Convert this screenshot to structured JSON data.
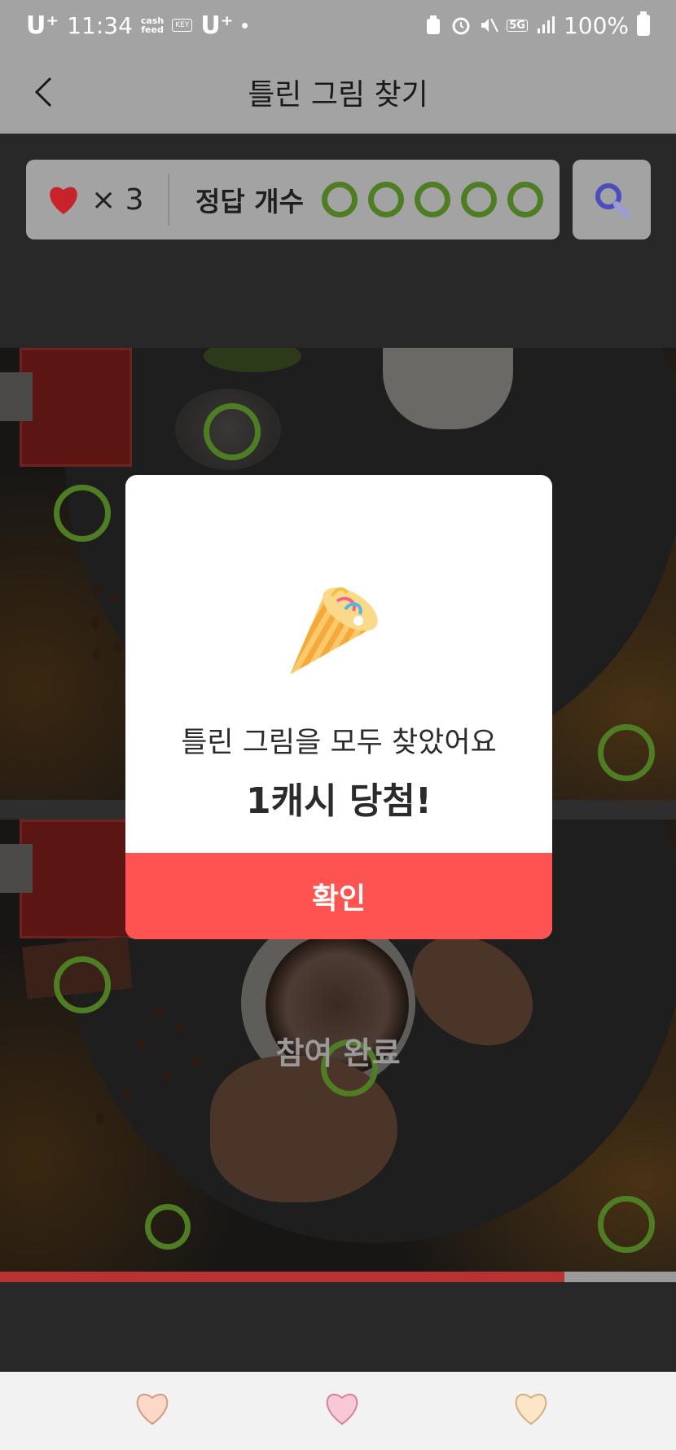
{
  "status_bar": {
    "carrier_left": "U⁺",
    "time": "11:34",
    "cashfeed_top": "cash",
    "cashfeed_bottom": "feed",
    "key_label": "KEY",
    "carrier_right": "U⁺",
    "network": "5G",
    "battery": "100%"
  },
  "header": {
    "title": "틀린 그림 찾기"
  },
  "info": {
    "lives_prefix": "×",
    "lives_count": "3",
    "answers_label": "정답 개수",
    "answers_found": 5,
    "answers_total": 5
  },
  "game": {
    "overlay_text": "참여 완료",
    "progress": 0.835
  },
  "modal": {
    "message": "틀린 그림을 모두 찾았어요",
    "reward": "1캐시 당첨!",
    "confirm_label": "확인"
  },
  "colors": {
    "accent_red": "#fd5451",
    "found_circle": "#4f7d24",
    "heart": "#c8232b",
    "search_icon": "#4c4ec0"
  },
  "bottom_nav": {
    "hearts": [
      "heart-peach-icon",
      "heart-pink-icon",
      "heart-cream-icon"
    ]
  }
}
